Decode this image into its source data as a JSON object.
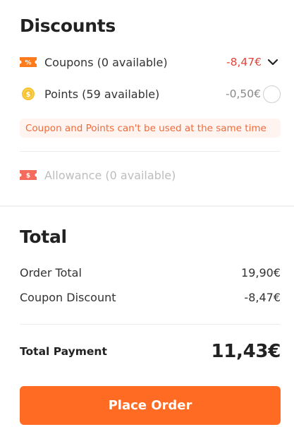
{
  "discounts": {
    "title": "Discounts",
    "coupons": {
      "label": "Coupons (0 available)",
      "amount": "-8,47€",
      "icon": "coupon-ticket-icon"
    },
    "points": {
      "label": "Points (59 available)",
      "amount": "-0,50€",
      "icon": "coin-icon",
      "selected": false
    },
    "warning": "Coupon and Points can't be used at the same time",
    "allowance": {
      "label": "Allowance (0 available)",
      "icon": "allowance-ticket-icon"
    }
  },
  "total": {
    "title": "Total",
    "order_total_label": "Order Total",
    "order_total_value": "19,90€",
    "coupon_discount_label": "Coupon Discount",
    "coupon_discount_value": "-8,47€",
    "payment_label": "Total Payment",
    "payment_value": "11,43€"
  },
  "place_order_label": "Place Order",
  "colors": {
    "accent": "#ff6b22",
    "discount_red": "#e0443a",
    "warning_text": "#f06a3a",
    "warning_bg": "#fff4f0",
    "coin": "#f6c12e"
  }
}
